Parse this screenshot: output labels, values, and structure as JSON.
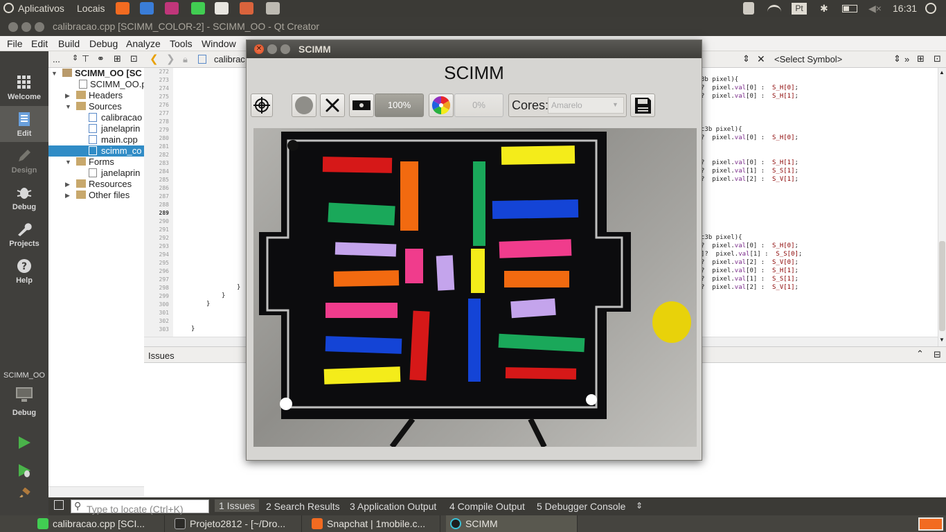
{
  "top_panel": {
    "apps_label": "Aplicativos",
    "places_label": "Locais",
    "lang": "Pt",
    "time": "16:31"
  },
  "window": {
    "title": "calibracao.cpp [SCIMM_COLOR-2] - SCIMM_OO - Qt Creator"
  },
  "menu": [
    "File",
    "Edit",
    "Build",
    "Debug",
    "Analyze",
    "Tools",
    "Window"
  ],
  "modes": [
    {
      "label": "Welcome",
      "icon": "grid-icon"
    },
    {
      "label": "Edit",
      "icon": "document-icon"
    },
    {
      "label": "Design",
      "icon": "pencil-icon"
    },
    {
      "label": "Debug",
      "icon": "bug-icon"
    },
    {
      "label": "Projects",
      "icon": "wrench-icon"
    },
    {
      "label": "Help",
      "icon": "help-icon"
    }
  ],
  "project_tree": {
    "root": "SCIMM_OO [SC",
    "pro_file": "SCIMM_OO.p",
    "headers": "Headers",
    "sources": "Sources",
    "files": [
      "calibracao",
      "janelaprin",
      "main.cpp",
      "scimm_co"
    ],
    "forms": "Forms",
    "form_files": [
      "janelaprin"
    ],
    "resources": "Resources",
    "other": "Other files",
    "toolbar_dots": "..."
  },
  "editor_toolbar": {
    "file_tab": "calibrac",
    "symbol_select": "<Select Symbol>"
  },
  "editor": {
    "line_numbers": [
      "272",
      "273",
      "274",
      "275",
      "276",
      "277",
      "278",
      "279",
      "280",
      "281",
      "282",
      "283",
      "284",
      "285",
      "286",
      "287",
      "288",
      "289",
      "290",
      "291",
      "292",
      "293",
      "294",
      "295",
      "296",
      "297",
      "298",
      "299",
      "300",
      "301",
      "302",
      "303"
    ],
    "left_code": [
      {
        "line": 298,
        "text": "}"
      },
      {
        "line": 299,
        "text": "}"
      },
      {
        "line": 300,
        "text": "}"
      },
      {
        "line": 303,
        "text": "}"
      }
    ],
    "right_code": [
      "3b pixel){",
      "?  pixel.val[0] :  S_H[0];",
      "?  pixel.val[0] :  S_H[1];",
      "",
      "",
      "",
      "c3b pixel){",
      "?  pixel.val[0] :  S_H[0];",
      "",
      "",
      "?  pixel.val[0] :  S_H[1];",
      "?  pixel.val[1] :  S_S[1];",
      "?  pixel.val[2] :  S_V[1];",
      "",
      "",
      "",
      "",
      "",
      "",
      "c3b pixel){",
      "?  pixel.val[0] :  S_H[0];",
      "]?  pixel.val[1] :  S_S[0];",
      "?  pixel.val[2] :  S_V[0];",
      "?  pixel.val[0] :  S_H[1];",
      "?  pixel.val[1] :  S_S[1];",
      "?  pixel.val[2] :  S_V[1];"
    ]
  },
  "issues_title": "Issues",
  "kit": {
    "project": "SCIMM_OO",
    "mode": "Debug"
  },
  "status": {
    "locator_placeholder": "Type to locate (Ctrl+K)",
    "tabs": [
      "1  Issues",
      "2  Search Results",
      "3  Application Output",
      "4  Compile Output",
      "5  Debugger Console"
    ]
  },
  "taskbar": [
    {
      "label": "calibracao.cpp [SCI...",
      "icon": "qt-icon"
    },
    {
      "label": "Projeto2812 - [~/Dro...",
      "icon": "terminal-icon"
    },
    {
      "label": "Snapchat | 1mobile.c...",
      "icon": "brave-icon"
    },
    {
      "label": "SCIMM",
      "icon": "scimm-icon"
    }
  ],
  "dialog": {
    "title": "SCIMM",
    "heading": "SCIMM",
    "zoom_label": "100%",
    "progress_label": "0%",
    "cores_label": "Cores:",
    "cores_value": "Amarelo"
  },
  "colors": {
    "red": "#d61818",
    "orange": "#f26a10",
    "green": "#1aa85a",
    "yellow": "#f4ec1a",
    "blue": "#1444d6",
    "pink": "#f03c8c",
    "lavender": "#c4a4ec",
    "selection": "#308cc6"
  }
}
